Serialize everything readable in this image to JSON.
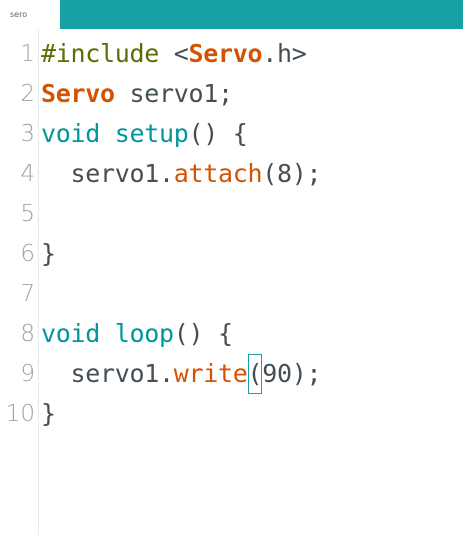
{
  "tab": {
    "label": "sero"
  },
  "colors": {
    "tabbar": "#17a1a5",
    "preprocessor": "#5e6d03",
    "type_keyword": "#00979c",
    "library_keyword": "#d35400",
    "function": "#d35400",
    "plain": "#434f54"
  },
  "editor": {
    "line_numbers": [
      "1",
      "2",
      "3",
      "4",
      "5",
      "6",
      "7",
      "8",
      "9",
      "10"
    ],
    "lines": [
      {
        "tokens": [
          {
            "t": "#include",
            "c": "pp"
          },
          {
            "t": " <",
            "c": "plain"
          },
          {
            "t": "Servo",
            "c": "kw-lib"
          },
          {
            "t": ".h>",
            "c": "plain"
          }
        ]
      },
      {
        "tokens": [
          {
            "t": "Servo",
            "c": "kw-lib"
          },
          {
            "t": " servo1;",
            "c": "plain"
          }
        ]
      },
      {
        "tokens": [
          {
            "t": "void",
            "c": "kw-type"
          },
          {
            "t": " ",
            "c": "plain"
          },
          {
            "t": "setup",
            "c": "kw-type"
          },
          {
            "t": "() {",
            "c": "plain"
          }
        ]
      },
      {
        "tokens": [
          {
            "t": "  servo1.",
            "c": "plain"
          },
          {
            "t": "attach",
            "c": "fn"
          },
          {
            "t": "(8);",
            "c": "plain"
          }
        ]
      },
      {
        "tokens": []
      },
      {
        "tokens": [
          {
            "t": "}",
            "c": "plain"
          }
        ]
      },
      {
        "tokens": []
      },
      {
        "tokens": [
          {
            "t": "void",
            "c": "kw-type"
          },
          {
            "t": " ",
            "c": "plain"
          },
          {
            "t": "loop",
            "c": "kw-type"
          },
          {
            "t": "() {",
            "c": "plain"
          }
        ]
      },
      {
        "tokens": [
          {
            "t": "  servo1.",
            "c": "plain"
          },
          {
            "t": "write",
            "c": "fn"
          },
          {
            "t": "(",
            "c": "plain",
            "cursor": true
          },
          {
            "t": "90);",
            "c": "plain"
          }
        ]
      },
      {
        "tokens": [
          {
            "t": "}",
            "c": "plain"
          }
        ]
      }
    ]
  }
}
